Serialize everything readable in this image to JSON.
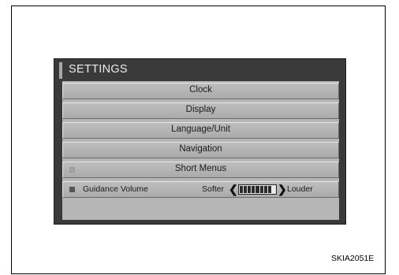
{
  "screen": {
    "title": "SETTINGS",
    "menu_items": [
      {
        "label": "Clock"
      },
      {
        "label": "Display"
      },
      {
        "label": "Language/Unit"
      },
      {
        "label": "Navigation"
      },
      {
        "label": "Short Menus",
        "indicator": "off"
      }
    ],
    "guidance_volume": {
      "label": "Guidance Volume",
      "indicator": "on",
      "softer_label": "Softer",
      "louder_label": "Louder",
      "level": 8,
      "max_level": 9
    }
  },
  "figure_id": "SKIA2051E",
  "colors": {
    "screen_bg": "#3a3a3a",
    "button_bg": "#b4b4b4",
    "title_text": "#ececec"
  }
}
